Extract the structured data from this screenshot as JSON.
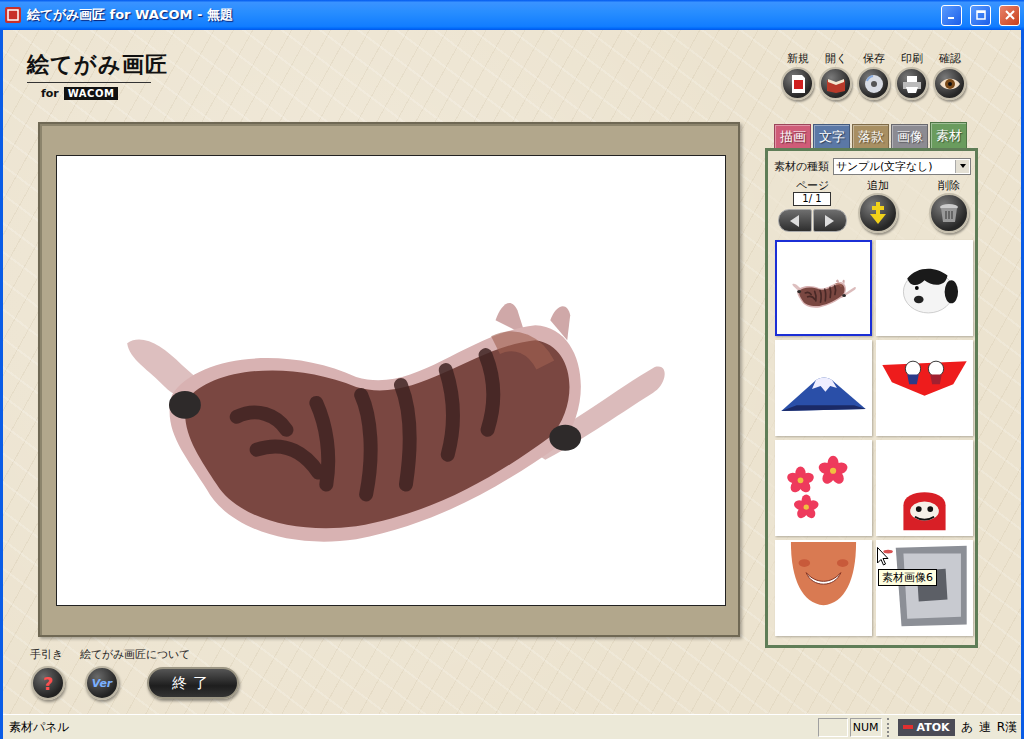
{
  "window": {
    "title": "絵てがみ画匠 for WACOM - 無題"
  },
  "logo": {
    "title": "絵てがみ画匠",
    "subtitle": "for",
    "brand": "WACOM"
  },
  "toolbar": [
    {
      "label": "新規",
      "kind": "new"
    },
    {
      "label": "開く",
      "kind": "open"
    },
    {
      "label": "保存",
      "kind": "save"
    },
    {
      "label": "印刷",
      "kind": "print"
    },
    {
      "label": "確認",
      "kind": "preview"
    }
  ],
  "tabs": [
    {
      "label": "描画",
      "selected": false,
      "color": "#cf5c78"
    },
    {
      "label": "文字",
      "selected": false,
      "color": "#5b78a6"
    },
    {
      "label": "落款",
      "selected": false,
      "color": "#a88f62"
    },
    {
      "label": "画像",
      "selected": false,
      "color": "#8c8b92"
    },
    {
      "label": "素材",
      "selected": true,
      "color": "#6a9c5e"
    }
  ],
  "material_panel": {
    "type_label": "素材の種類",
    "type_value": "サンプル(文字なし)",
    "page_label": "ページ",
    "page": "1/ 1",
    "add_label": "追加",
    "delete_label": "削除",
    "thumbnails": [
      {
        "kind": "cat",
        "selected": true
      },
      {
        "kind": "dog",
        "selected": false
      },
      {
        "kind": "fuji",
        "selected": false
      },
      {
        "kind": "cloth",
        "selected": false
      },
      {
        "kind": "flowers",
        "selected": false
      },
      {
        "kind": "daruma",
        "selected": false
      },
      {
        "kind": "face",
        "selected": false
      },
      {
        "kind": "device",
        "selected": false
      }
    ],
    "tooltip": "素材画像6"
  },
  "footer": {
    "help_label": "手引き",
    "about_label": "絵てがみ画匠について",
    "help_button": "?",
    "version_button": "Ver",
    "exit_button": "終了"
  },
  "status_bar": {
    "text": "素材パネル",
    "num": "NUM",
    "ime": [
      "ATOK",
      "あ",
      "連",
      "R漢"
    ]
  }
}
